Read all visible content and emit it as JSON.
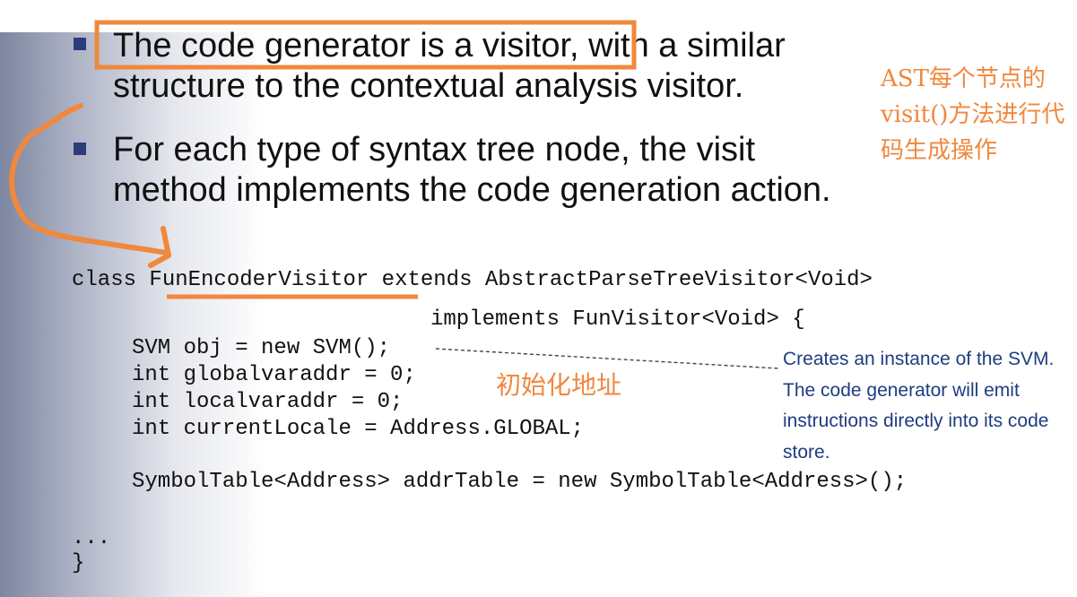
{
  "bullets": [
    {
      "line1": "The code generator is a visitor, with a similar",
      "line2": "structure to the contextual analysis visitor."
    },
    {
      "line1": "For each type of syntax tree node, the visit",
      "line2": "method implements the code generation action."
    }
  ],
  "code": {
    "line1_prefix": "class ",
    "line1_class": "FunEncoderVisitor",
    "line1_suffix": " extends AbstractParseTreeVisitor<Void>",
    "line2": "implements FunVisitor<Void> {",
    "line3": "SVM obj = new SVM();",
    "line4": "int globalvaraddr = 0;",
    "line5": "int localvaraddr = 0;",
    "line6": "int currentLocale = Address.GLOBAL;",
    "line7": "SymbolTable<Address> addrTable = new SymbolTable<Address>();",
    "line8": "...",
    "line9": "}"
  },
  "annotations": {
    "right_note": "AST每个节点的visit()方法进行代码生成操作",
    "init_note": "初始化地址",
    "svm_note": "Creates an instance of the SVM. The code generator will emit instructions directly into its code store."
  },
  "colors": {
    "highlight": "#f0883e",
    "bullet": "#2b3c78",
    "note_text": "#1f3c80"
  }
}
